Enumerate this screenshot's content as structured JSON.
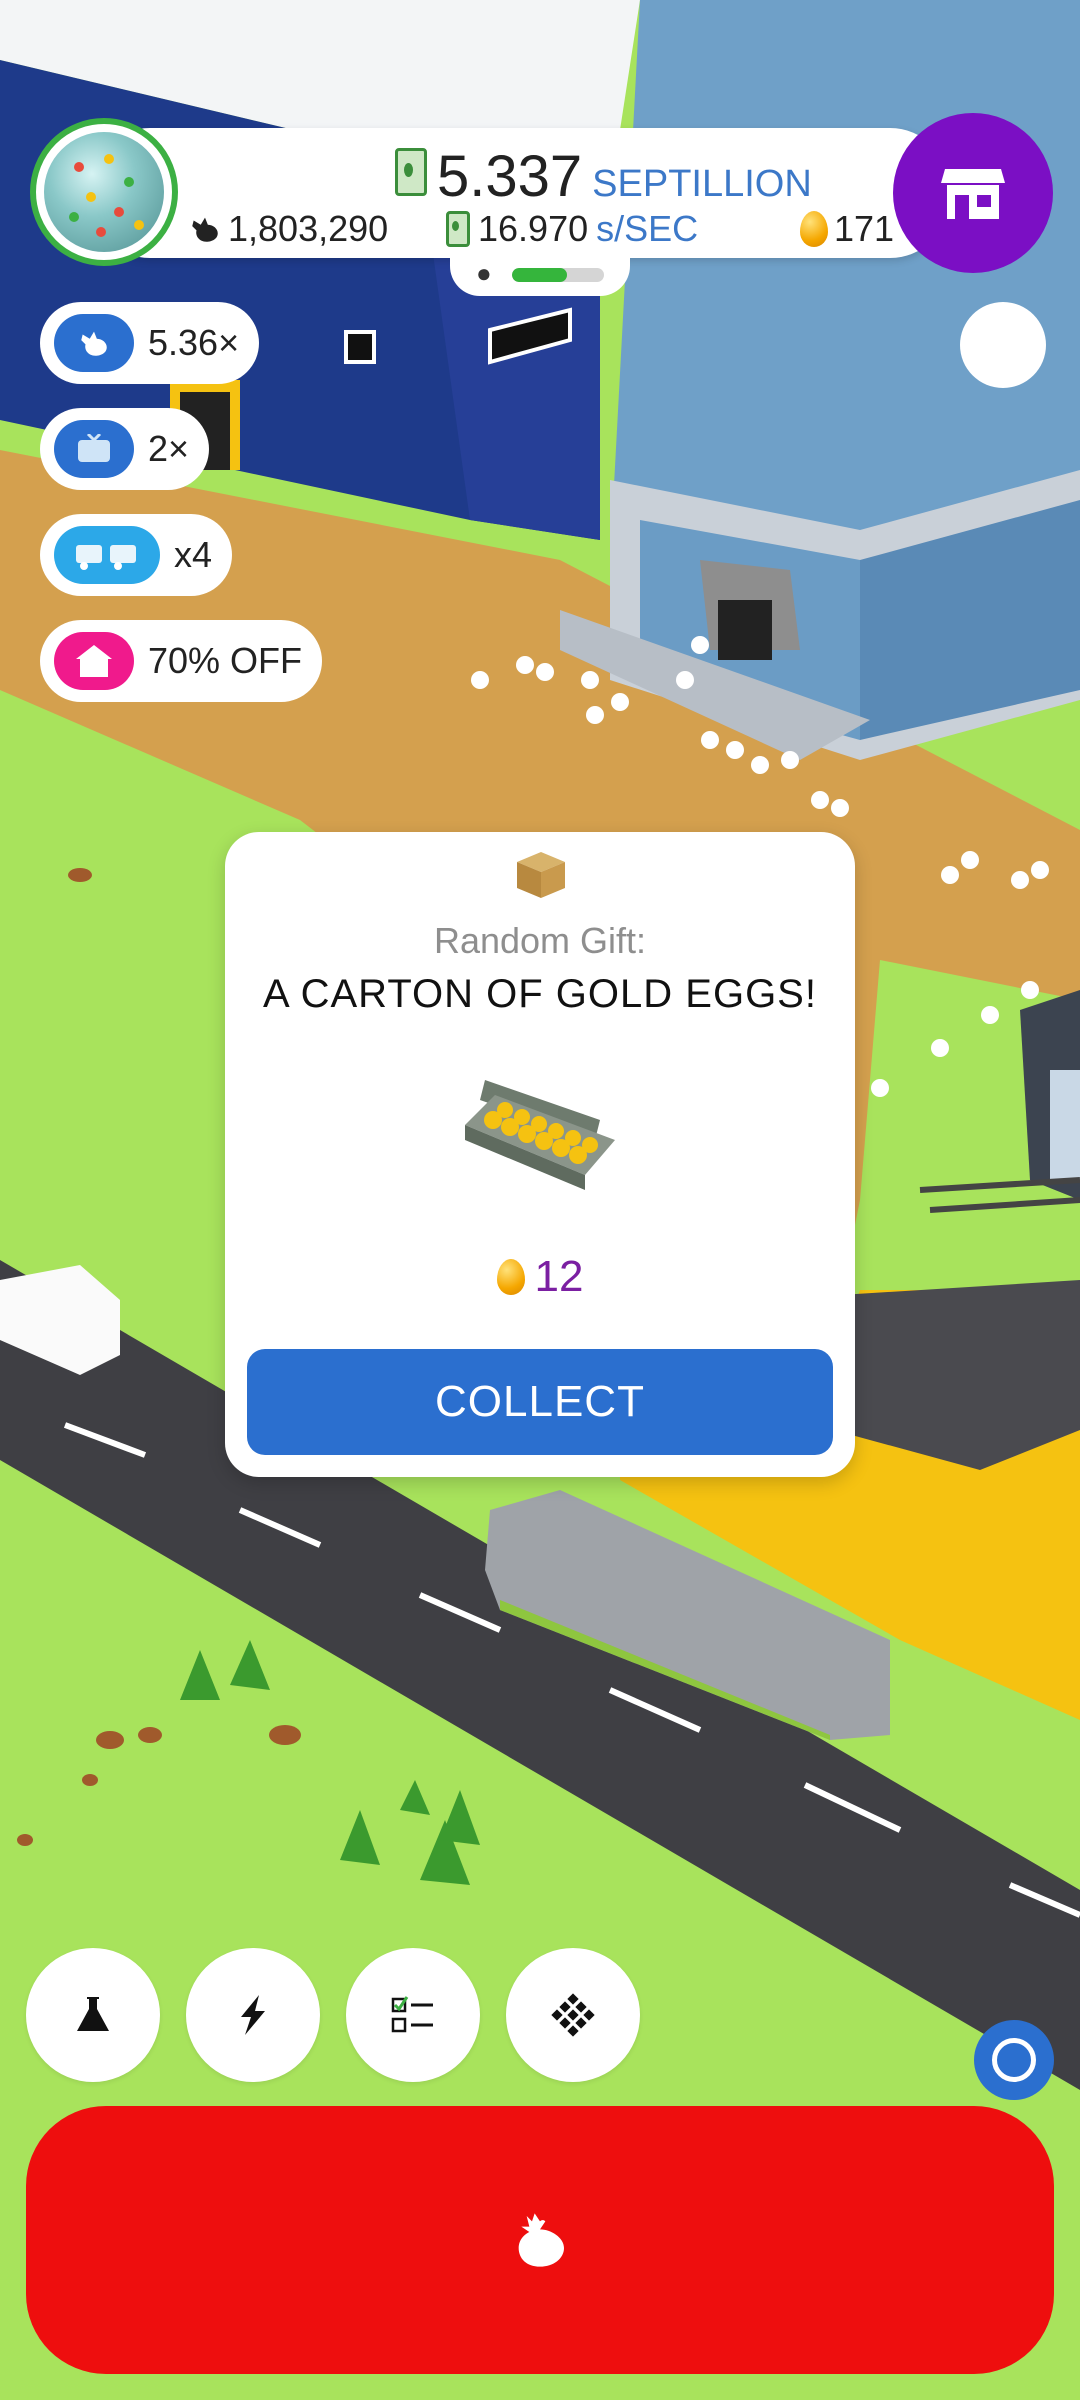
{
  "header": {
    "money_value": "5.337",
    "money_unit": "SEPTILLION",
    "chicken_count": "1,803,290",
    "rate_value": "16.970",
    "rate_unit": "s/SEC",
    "golden_eggs": "171",
    "habitat_progress": 0.6
  },
  "boosts": [
    {
      "label": "5.36×",
      "icon": "chicken-icon",
      "color": "#2b6fcf"
    },
    {
      "label": "2×",
      "icon": "tv-icon",
      "color": "#2b6fcf"
    },
    {
      "label": "x4",
      "icon": "truck-icon",
      "color": "#2ca8e8"
    },
    {
      "label": "70% OFF",
      "icon": "shop-icon",
      "color": "#f01a8c"
    }
  ],
  "modal": {
    "label": "Random Gift:",
    "title": "A CARTON OF GOLD EGGS!",
    "reward_amount": "12",
    "collect_label": "COLLECT"
  },
  "bottom_bar": {
    "buttons": [
      "flask-icon",
      "lightning-icon",
      "checklist-icon",
      "grid-icon"
    ],
    "main_action_icon": "chicken-icon",
    "main_action_color": "#ee0e0e"
  },
  "colors": {
    "grass": "#a8e35c",
    "shop_button": "#7b0fc4",
    "primary_blue": "#2b6fcf",
    "currency_unit": "#3c78c8",
    "reward_purple": "#7b1fa2"
  }
}
